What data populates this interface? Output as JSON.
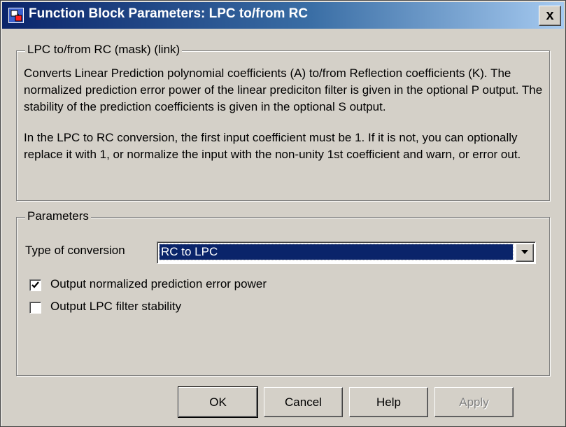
{
  "window": {
    "title": "Function Block Parameters: LPC to/from RC",
    "close_glyph": "x"
  },
  "description_group": {
    "legend": "LPC to/from RC (mask) (link)",
    "paragraphs": [
      "Converts Linear Prediction polynomial coefficients (A) to/from Reflection coefficients (K). The normalized prediction error power of the linear prediciton filter is given in the optional P output. The stability of the prediction coefficients is given in the optional S output.",
      "In the LPC to RC conversion, the first input coefficient must be 1. If it is not, you can optionally replace it with 1, or normalize the input with the non-unity 1st coefficient and warn, or error out."
    ]
  },
  "parameters_group": {
    "legend": "Parameters",
    "conversion_label": "Type of conversion",
    "conversion_value": "RC to LPC",
    "checkboxes": [
      {
        "label": "Output normalized prediction error power",
        "checked": true
      },
      {
        "label": "Output LPC filter stability",
        "checked": false
      }
    ]
  },
  "buttons": {
    "ok": "OK",
    "cancel": "Cancel",
    "help": "Help",
    "apply": "Apply"
  },
  "icons": {
    "app": "simulink-block-icon",
    "dropdown": "chevron-down-icon",
    "check": "checkmark-icon"
  }
}
